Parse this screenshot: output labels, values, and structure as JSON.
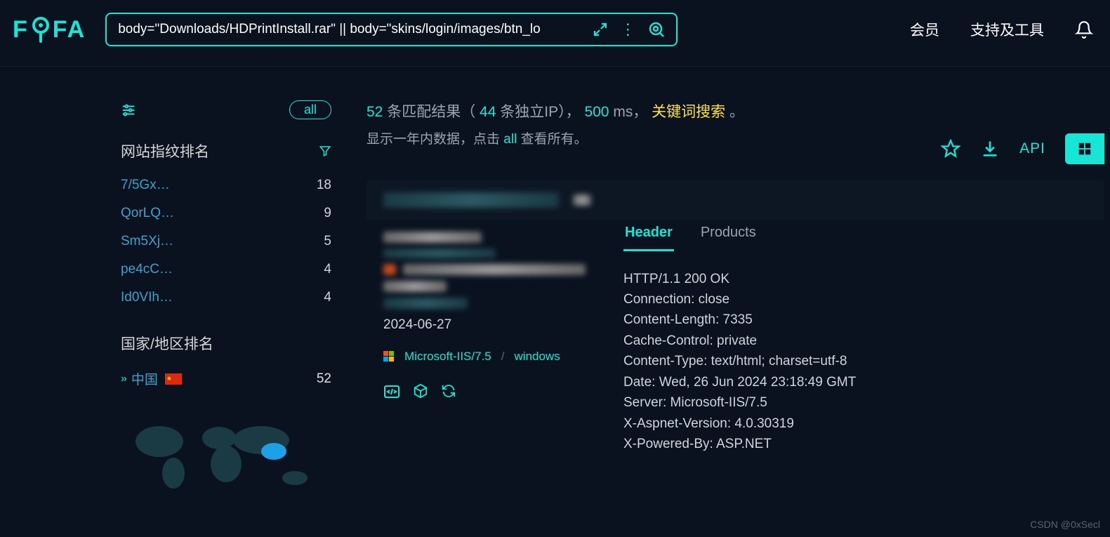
{
  "header": {
    "logo_text_pre": "F",
    "logo_text_post": "FA",
    "search_value": "body=\"Downloads/HDPrintInstall.rar\" || body=\"skins/login/images/btn_lo",
    "nav_member": "会员",
    "nav_support": "支持及工具"
  },
  "sidebar": {
    "pill_all": "all",
    "section_fingerprint_title": "网站指纹排名",
    "fingerprint_ranks": [
      {
        "name": "7/5Gx…",
        "count": "18"
      },
      {
        "name": "QorLQ…",
        "count": "9"
      },
      {
        "name": "Sm5Xj…",
        "count": "5"
      },
      {
        "name": "pe4cC…",
        "count": "4"
      },
      {
        "name": "Id0VIh…",
        "count": "4"
      }
    ],
    "section_country_title": "国家/地区排名",
    "country": {
      "name": "中国",
      "count": "52"
    }
  },
  "summary": {
    "total": "52",
    "txt_match": " 条匹配结果（",
    "ip_count": "44",
    "txt_ip": " 条独立IP）， ",
    "ms": "500",
    "txt_ms": " ms， ",
    "kw_label": "关键词搜索",
    "period": "。",
    "sub_pre": "显示一年内数据，点击 ",
    "sub_all": "all",
    "sub_post": " 查看所有。"
  },
  "toolbar": {
    "api_label": "API"
  },
  "card": {
    "date": "2024-06-27",
    "iis_label": "Microsoft-IIS/7.5",
    "sep": "/",
    "os_label": "windows",
    "tabs": {
      "header": "Header",
      "products": "Products"
    },
    "headers_text": "HTTP/1.1 200 OK\nConnection: close\nContent-Length: 7335\nCache-Control: private\nContent-Type: text/html; charset=utf-8\nDate: Wed, 26 Jun 2024 23:18:49 GMT\nServer: Microsoft-IIS/7.5\nX-Aspnet-Version: 4.0.30319\nX-Powered-By: ASP.NET"
  },
  "watermark": "CSDN @0xSecl"
}
